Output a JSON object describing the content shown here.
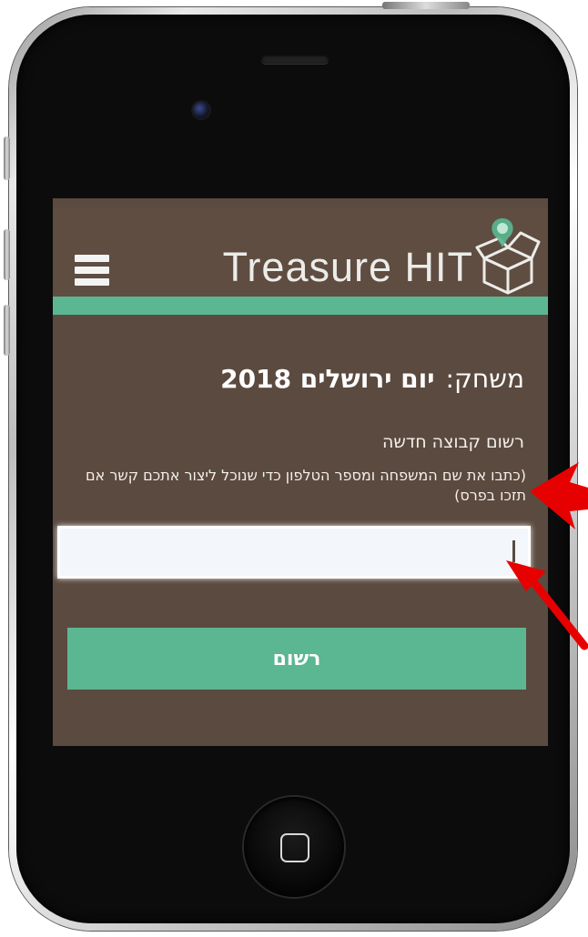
{
  "app": {
    "brand": "Treasure HIT",
    "menu_icon": "hamburger-icon",
    "logo_icon": "treasure-box-icon"
  },
  "game": {
    "label": "משחק:",
    "name": "יום ירושלים 2018"
  },
  "registration": {
    "title": "רשום קבוצה חדשה",
    "hint": "(כתבו את שם המשפחה ומספר הטלפון כדי שנוכל ליצור אתכם קשר אם תזכו בפרס)",
    "input_value": "",
    "button_label": "רשום"
  },
  "colors": {
    "screen_bg": "#5b4a3f",
    "accent_green": "#5bb791",
    "annotation_red": "#e60000"
  }
}
